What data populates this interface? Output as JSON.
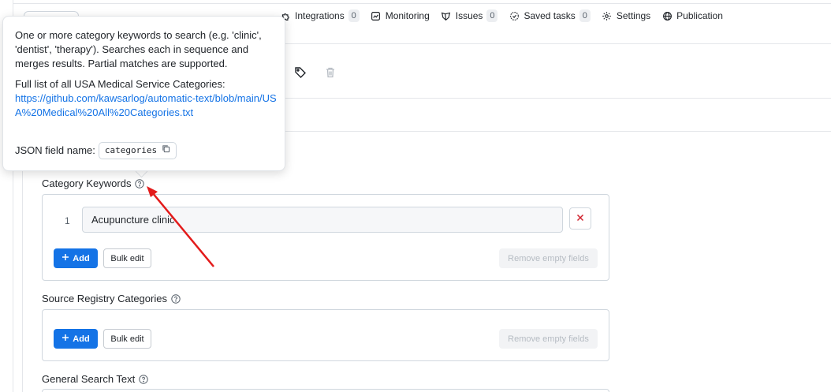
{
  "nav": {
    "tabs": [
      {
        "label": "Integrations",
        "count": "0",
        "icon": "puzzle-icon"
      },
      {
        "label": "Monitoring",
        "icon": "chart-icon"
      },
      {
        "label": "Issues",
        "count": "0",
        "icon": "bug-icon"
      },
      {
        "label": "Saved tasks",
        "count": "0",
        "icon": "saved-tasks-icon"
      },
      {
        "label": "Settings",
        "icon": "gear-icon"
      },
      {
        "label": "Publication",
        "icon": "globe-icon"
      }
    ]
  },
  "tooltip": {
    "description": "One or more category keywords to search (e.g. 'clinic', 'dentist', 'therapy'). Searches each in sequence and merges results. Partial matches are supported.",
    "full_list_label": "Full list of all USA Medical Service Categories:",
    "link": "https://github.com/kawsarlog/automatic-text/blob/main/USA%20Medical%20All%20Categories.txt",
    "json_label": "JSON field name:",
    "json_field": "categories"
  },
  "fields": {
    "category_keywords": {
      "label": "Category Keywords",
      "items": [
        {
          "index": "1",
          "value": "Acupuncture clinic"
        }
      ],
      "add_label": "Add",
      "bulk_label": "Bulk edit",
      "remove_empty_label": "Remove empty fields"
    },
    "source_registry": {
      "label": "Source Registry Categories",
      "add_label": "Add",
      "bulk_label": "Bulk edit",
      "remove_empty_label": "Remove empty fields"
    },
    "general_search": {
      "label": "General Search Text"
    }
  },
  "colors": {
    "primary": "#1473e6",
    "danger": "#d1242f",
    "annotation_arrow": "#e31b1b"
  }
}
